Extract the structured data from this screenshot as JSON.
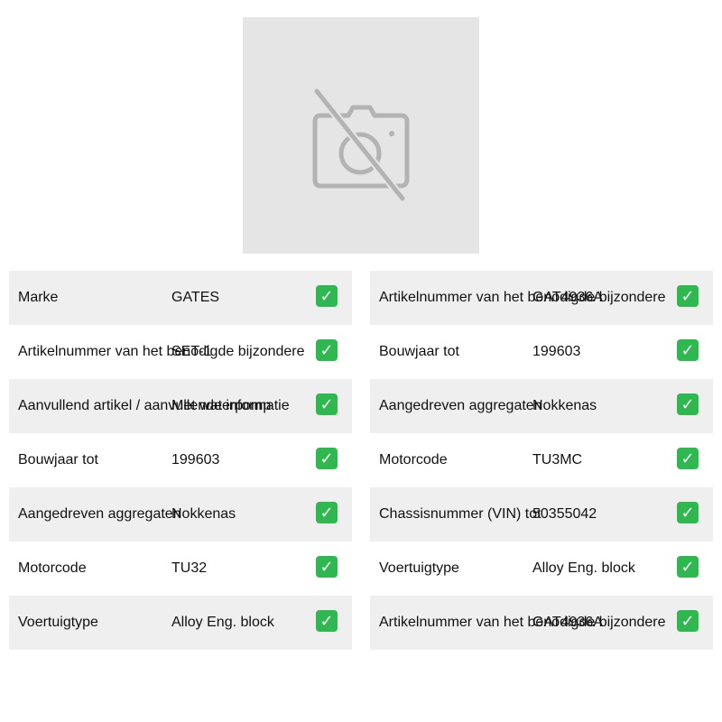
{
  "icons": {
    "photo_placeholder": "camera-off-icon",
    "check": "check-mark-icon"
  },
  "colors": {
    "placeholder_bg": "#e5e5e5",
    "placeholder_icon": "#b3b3b3",
    "row_alt_bg": "#efefef",
    "check_bg": "#2fb84f"
  },
  "left_table": [
    {
      "label": "Marke",
      "value": "GATES"
    },
    {
      "label": "Artikelnummer van het benodigde bijzondere",
      "value": "SET-1"
    },
    {
      "label": "Aanvullend artikel / aanvullende informatie",
      "value": "Met waterpomp"
    },
    {
      "label": "Bouwjaar tot",
      "value": "199603"
    },
    {
      "label": "Aangedreven aggregaten",
      "value": "Nokkenas"
    },
    {
      "label": "Motorcode",
      "value": "TU32"
    },
    {
      "label": "Voertuigtype",
      "value": "Alloy Eng. block"
    }
  ],
  "right_table": [
    {
      "label": "Artikelnummer van het benodigde bijzondere",
      "value": "GAT4936A"
    },
    {
      "label": "Bouwjaar tot",
      "value": "199603"
    },
    {
      "label": "Aangedreven aggregaten",
      "value": "Nokkenas"
    },
    {
      "label": "Motorcode",
      "value": "TU3MC"
    },
    {
      "label": "Chassisnummer (VIN) tot",
      "value": "50355042"
    },
    {
      "label": "Voertuigtype",
      "value": "Alloy Eng. block"
    },
    {
      "label": "Artikelnummer van het benodigde bijzondere",
      "value": "GAT4936A"
    }
  ],
  "check_symbol": "✓"
}
